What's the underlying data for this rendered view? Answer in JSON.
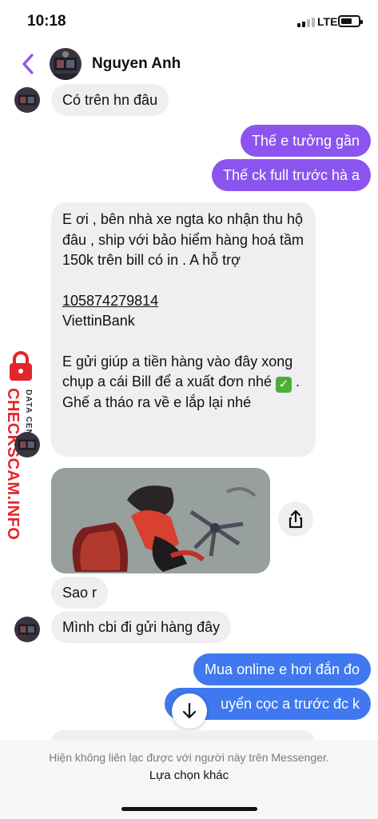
{
  "status_bar": {
    "time": "10:18",
    "network": "LTE"
  },
  "header": {
    "contact_name": "Nguyen Anh"
  },
  "messages": {
    "m1": "Có trên hn đâu",
    "m2": "Thế e tưởng gần",
    "m3": "Thế ck full trước hà a",
    "m4_line1": "E ơi , bên nhà xe ngta ko nhận thu hộ đâu , ship với bảo hiểm hàng hoá tầm 150k trên bill có in . A hỗ trợ",
    "m4_account": "105874279814",
    "m4_bank": "ViettinBank",
    "m4_line3": "E gửi giúp a tiền hàng vào đây xong chụp a cái Bill để a xuất đơn nhé",
    "m4_line3_end": ". Ghế a tháo ra về e lắp lại nhé",
    "m4_check": "✓",
    "m5": "Sao r",
    "m6": "Mình cbi đi gửi hàng đây",
    "m7": "Mua online e hơi đắn đo",
    "m8": "uyển cọc a trước đc k"
  },
  "watermark": {
    "brand": "CHECKSCAM.INFO",
    "small": "DATA CENTER"
  },
  "footer": {
    "note": "Hiện không liên lạc được với người này trên Messenger.",
    "link": "Lựa chọn khác"
  },
  "colors": {
    "purple_bubble": "#8b54ee",
    "blue_bubble": "#3f78ef",
    "incoming_bubble": "#efeff1",
    "back_arrow": "#8b54ee"
  },
  "icons": [
    "back-chevron-icon",
    "share-icon",
    "arrow-down-icon",
    "lock-icon",
    "checkmark-icon"
  ]
}
